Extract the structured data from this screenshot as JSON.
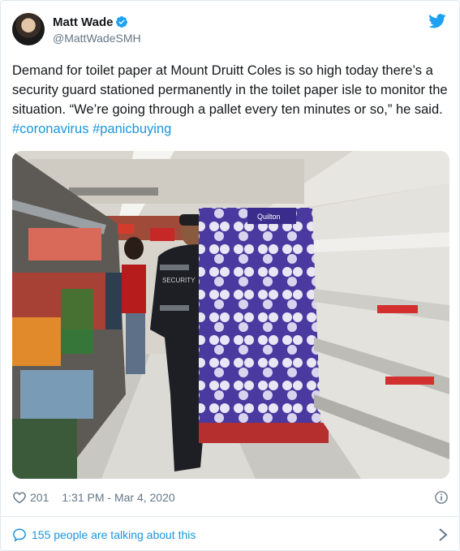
{
  "author": {
    "name": "Matt Wade",
    "handle": "@MattWadeSMH"
  },
  "tweet": {
    "text": "Demand for toilet paper at Mount Druitt Coles is so high today there’s a security guard stationed permanently in the toilet paper isle to monitor the situation. “We’re going through a pallet every ten minutes or so,” he said.",
    "hashtags": [
      "#coronavirus",
      "#panicbuying"
    ]
  },
  "photo": {
    "shelf_brand": "Quilton",
    "vest_text": "SECURITY"
  },
  "meta": {
    "likes": "201",
    "timestamp": "1:31 PM - Mar 4, 2020"
  },
  "footer": {
    "talk_label": "155 people are talking about this"
  },
  "colors": {
    "link": "#1b95e0",
    "muted": "#657786",
    "border": "#e1e8ed"
  },
  "icons": [
    "twitter-bird-icon",
    "verified-badge-icon",
    "heart-icon",
    "info-icon",
    "speech-bubble-icon",
    "chevron-right-icon"
  ]
}
